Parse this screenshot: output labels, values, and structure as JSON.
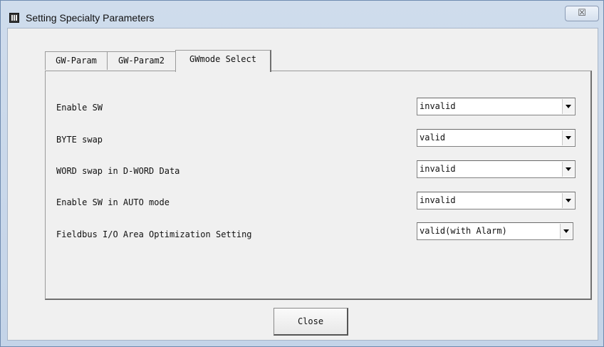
{
  "window": {
    "title": "Setting Specialty Parameters",
    "close_glyph": "☒"
  },
  "tabs": [
    {
      "label": "GW-Param"
    },
    {
      "label": "GW-Param2"
    },
    {
      "label": "GWmode Select"
    }
  ],
  "rows": [
    {
      "label": "Enable SW",
      "value": "invalid"
    },
    {
      "label": "BYTE swap",
      "value": "valid"
    },
    {
      "label": "WORD swap in D-WORD Data",
      "value": "invalid"
    },
    {
      "label": "Enable SW in AUTO mode",
      "value": "invalid"
    },
    {
      "label": "Fieldbus I/O Area Optimization Setting",
      "value": "valid(with Alarm)"
    }
  ],
  "footer": {
    "close_label": "Close"
  }
}
